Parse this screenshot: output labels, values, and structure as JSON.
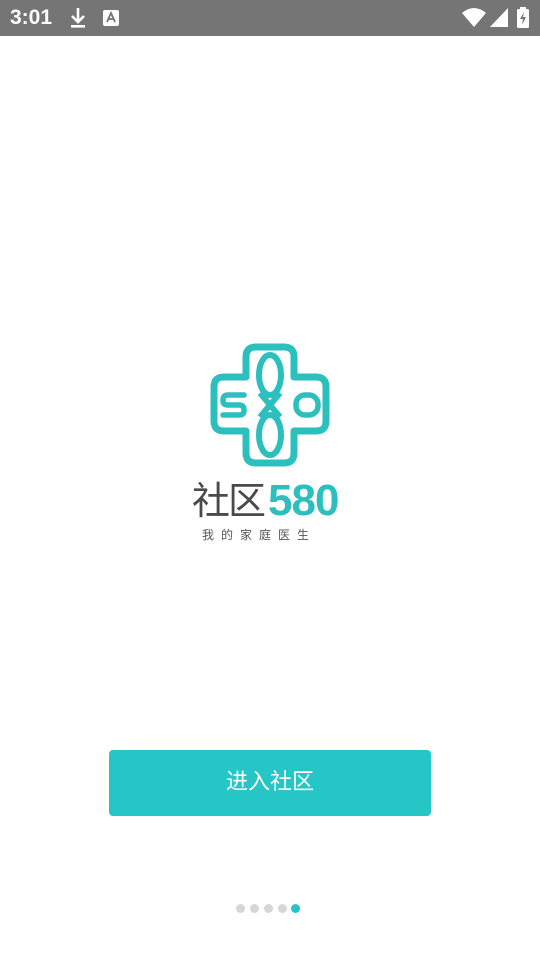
{
  "status_bar": {
    "time": "3:01",
    "icons": [
      "download-icon",
      "text-a-icon",
      "wifi-icon",
      "cell-signal-icon",
      "battery-charging-icon"
    ],
    "background": "#757575"
  },
  "logo": {
    "mark_letters": "580",
    "brand_cn": "社区",
    "brand_num": "580",
    "slogan": "我的家庭医生"
  },
  "enter_button": {
    "label": "进入社区"
  },
  "page_indicator": {
    "total": 5,
    "active_index": 4
  },
  "colors": {
    "accent": "#26c6c6",
    "brand_text": "#4a4a4a",
    "dot_inactive": "#d6d6d6"
  }
}
